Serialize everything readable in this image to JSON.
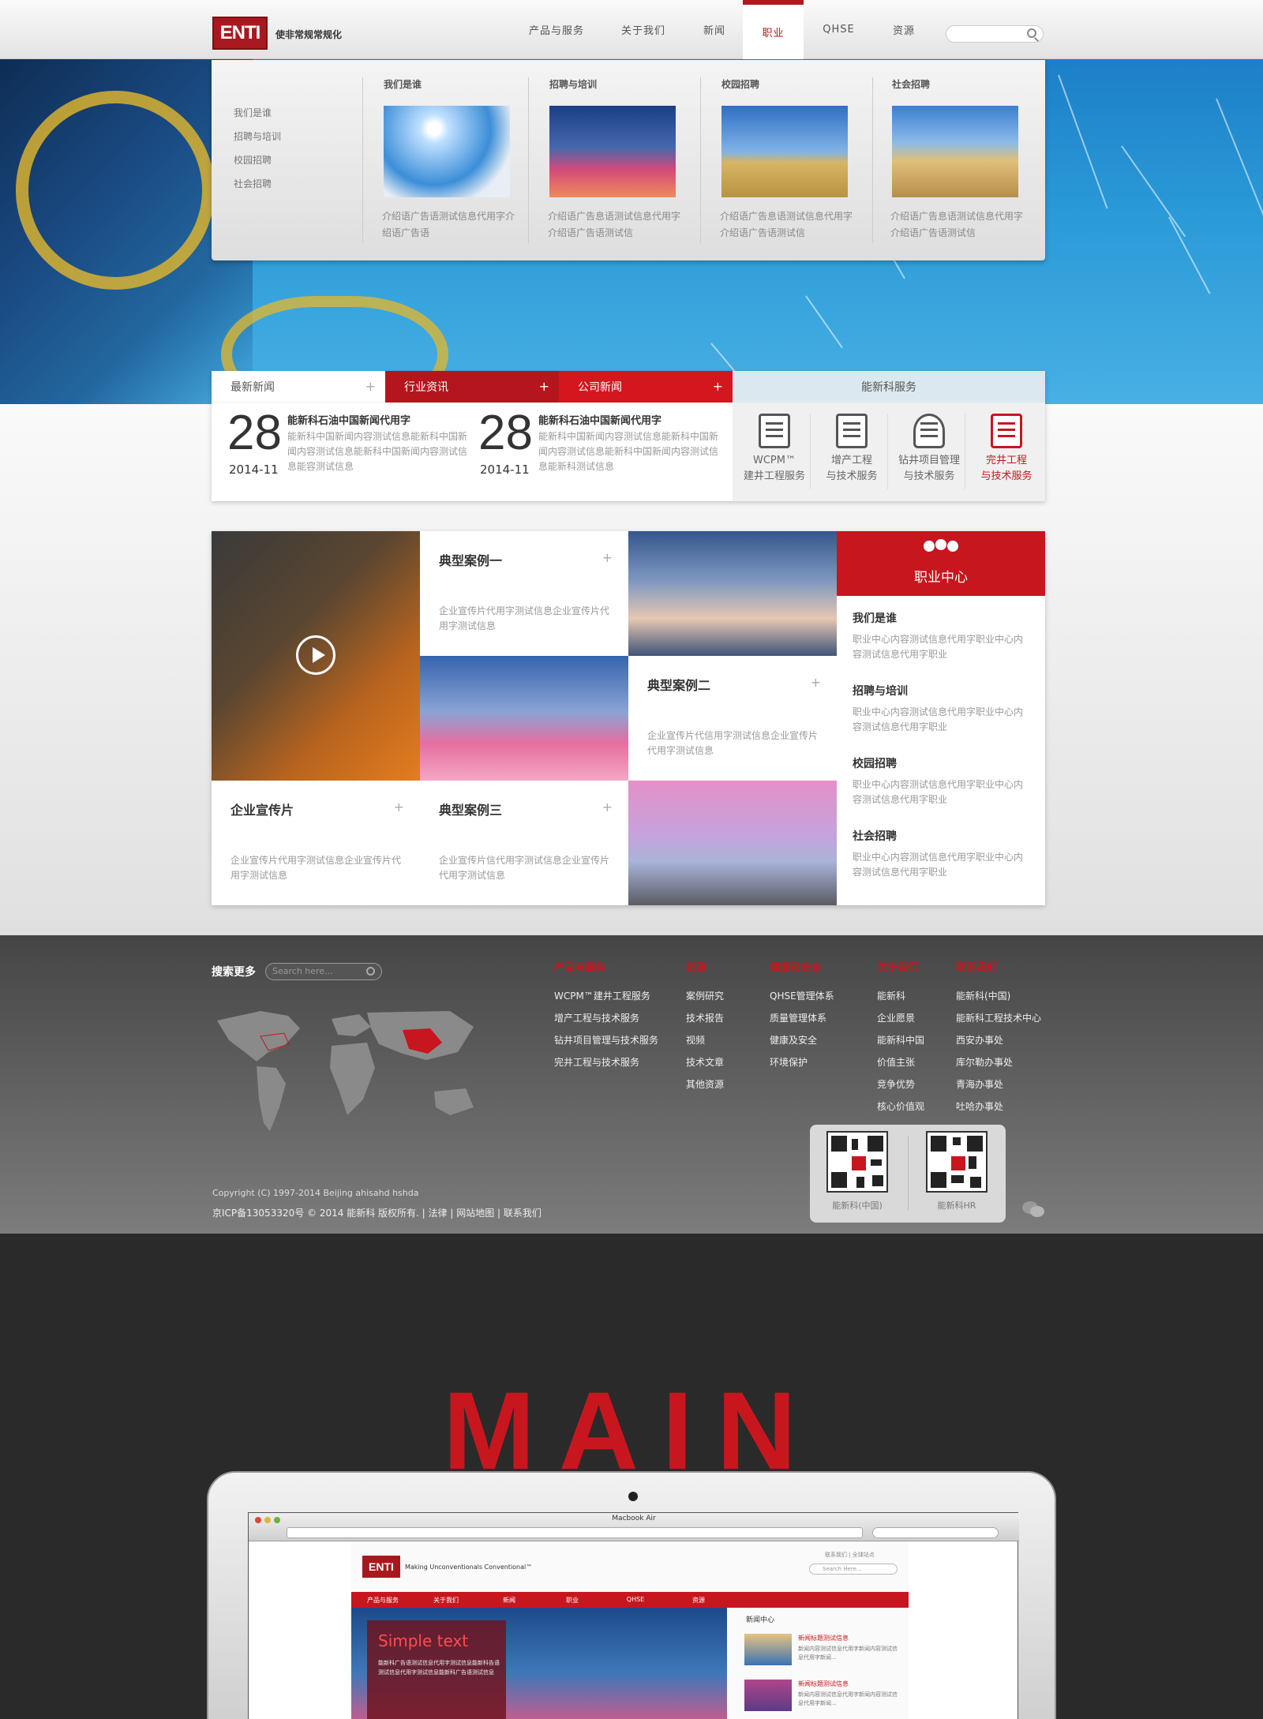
{
  "header": {
    "logo": "ENTI",
    "slogan": "使非常规常规化",
    "nav": [
      "产品与服务",
      "关于我们",
      "新闻",
      "职业",
      "QHSE",
      "资源"
    ],
    "active_nav": "职业"
  },
  "dropdown": {
    "links": [
      "我们是谁",
      "招聘与培训",
      "校园招聘",
      "社会招聘"
    ],
    "columns": [
      {
        "title": "我们是谁",
        "desc": "介绍语广告语测试信息代用字介绍语广告语"
      },
      {
        "title": "招聘与培训",
        "desc": "介绍语广告息语测试信息代用字介绍语广告语测试信"
      },
      {
        "title": "校园招聘",
        "desc": "介绍语广告息语测试信息代用字介绍语广告语测试信"
      },
      {
        "title": "社会招聘",
        "desc": "介绍语广告息语测试信息代用字介绍语广告语测试信"
      }
    ]
  },
  "news": {
    "tabs": [
      "最新新闻",
      "行业资讯",
      "公司新闻"
    ],
    "service_title": "能新科服务",
    "items": [
      {
        "day": "28",
        "ym": "2014-11",
        "title": "能新科石油中国新闻代用字",
        "body": "能新科中国新闻内容测试信息能新科中国新闻内容测试信息能新科中国新闻内容测试信息能容测试信息"
      },
      {
        "day": "28",
        "ym": "2014-11",
        "title": "能新科石油中国新闻代用字",
        "body": "能新科中国新闻内容测试信息能新科中国新闻内容测试信息能新科中国新闻内容测试信息能新科测试信息"
      }
    ],
    "services": [
      {
        "line1": "WCPM™",
        "line2": "建井工程服务"
      },
      {
        "line1": "增产工程",
        "line2": "与技术服务"
      },
      {
        "line1": "钻井项目管理",
        "line2": "与技术服务"
      },
      {
        "line1": "完井工程",
        "line2": "与技术服务"
      }
    ]
  },
  "cases": {
    "case1": {
      "title": "典型案例一",
      "desc": "企业宣传片代用字测试信息企业宣传片代用字测试信息"
    },
    "case2": {
      "title": "典型案例二",
      "desc": "企业宣传片代信用字测试信息企业宣传片代用字测试信息"
    },
    "case3": {
      "title": "典型案例三",
      "desc": "企业宣传片信代用字测试信息企业宣传片代用字测试信息"
    },
    "promo": {
      "title": "企业宣传片",
      "desc": "企业宣传片代用字测试信息企业宣传片代用字测试信息"
    },
    "career": {
      "title": "职业中心",
      "items": [
        {
          "title": "我们是谁",
          "desc": "职业中心内容测试信息代用字职业中心内容测试信息代用字职业"
        },
        {
          "title": "招聘与培训",
          "desc": "职业中心内容测试信息代用字职业中心内容测试信息代用字职业"
        },
        {
          "title": "校园招聘",
          "desc": "职业中心内容测试信息代用字职业中心内容测试信息代用字职业"
        },
        {
          "title": "社会招聘",
          "desc": "职业中心内容测试信息代用字职业中心内容测试信息代用字职业"
        }
      ]
    }
  },
  "footer": {
    "search_label": "搜索更多",
    "search_placeholder": "Search here...",
    "columns": [
      {
        "heading": "产品与服务",
        "links": [
          "WCPM™建井工程服务",
          "增产工程与技术服务",
          "钻井项目管理与技术服务",
          "完井工程与技术服务"
        ]
      },
      {
        "heading": "资源",
        "links": [
          "案例研究",
          "技术报告",
          "视频",
          "技术文章",
          "其他资源"
        ]
      },
      {
        "heading": "健康和安全",
        "links": [
          "QHSE管理体系",
          "质量管理体系",
          "健康及安全",
          "环境保护"
        ]
      },
      {
        "heading": "关于我们",
        "links": [
          "能新科",
          "企业愿景",
          "能新科中国",
          "价值主张",
          "竞争优势",
          "核心价值观"
        ]
      },
      {
        "heading": "联系我们",
        "links": [
          "能新科(中国)",
          "能新科工程技术中心",
          "西安办事处",
          "库尔勒办事处",
          "青海办事处",
          "吐哈办事处"
        ]
      }
    ],
    "qr": [
      "能新科(中国)",
      "能新科HR"
    ],
    "copyright1": "Copyright (C) 1997-2014  Beijing ahisahd  hshda",
    "copyright2": "京ICP备13053320号  © 2014 能新科 版权所有. | 法律 | 网站地图 | 联系我们"
  },
  "main": {
    "word": "MAIN",
    "browser_title": "Macbook Air",
    "inner_logo": "ENTI",
    "inner_tagline": "Making Unconventionals Conventional™",
    "inner_links": "联系我们 | 全球站点",
    "inner_search": "Search Here...",
    "inner_nav": [
      "产品与服务",
      "关于我们",
      "新闻",
      "职业",
      "QHSE",
      "资源"
    ],
    "inner_box_title": "Simple  text",
    "inner_box_desc": "能新科广告语测试信息代用字测试信息能新科告语测试信息代用字测试信息能新科广告语测试信息",
    "inner_news_title": "新闻中心",
    "inner_news": [
      {
        "title": "新闻标题测试信息",
        "body": "新闻内容测试信息代用字新闻内容测试信息代用字新闻..."
      },
      {
        "title": "新闻标题测试信息",
        "body": "新闻内容测试信息代用字新闻内容测试信息代用字新闻..."
      }
    ]
  }
}
